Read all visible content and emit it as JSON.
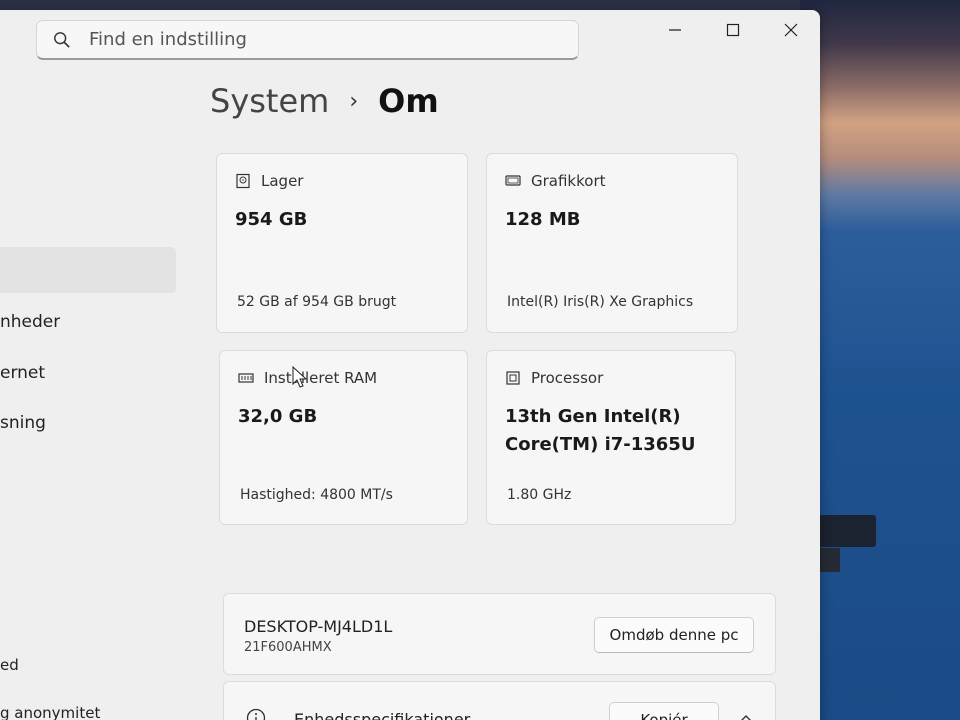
{
  "search": {
    "placeholder": "Find en indstilling"
  },
  "sidebar": {
    "items": [
      {
        "label": "nheder"
      },
      {
        "label": "ernet"
      },
      {
        "label": "sning"
      },
      {
        "label": "ed"
      },
      {
        "label": "g anonymitet"
      }
    ]
  },
  "breadcrumb": {
    "parent": "System",
    "separator": "›",
    "current": "Om"
  },
  "cards": {
    "storage": {
      "label": "Lager",
      "value": "954 GB",
      "sub": "52 GB af 954 GB brugt",
      "icon": "drive-icon"
    },
    "graphics": {
      "label": "Grafikkort",
      "value": "128 MB",
      "sub": "Intel(R) Iris(R) Xe Graphics",
      "icon": "display-icon"
    },
    "ram": {
      "label": "Installeret RAM",
      "value": "32,0 GB",
      "sub": "Hastighed: 4800 MT/s",
      "icon": "memory-icon"
    },
    "processor": {
      "label": "Processor",
      "value_line1": "13th Gen Intel(R)",
      "value_line2": "Core(TM) i7-1365U",
      "sub": "1.80 GHz",
      "icon": "cpu-icon"
    }
  },
  "device": {
    "name": "DESKTOP-MJ4LD1L",
    "serial": "21F600AHMX",
    "rename_label": "Omdøb denne pc"
  },
  "specs": {
    "label": "Enhedsspecifikationer",
    "copy_label": "Kopiér"
  },
  "colors": {
    "window_bg": "#efefef",
    "card_bg": "#f6f6f6",
    "selected_bg": "#e3e3e3"
  }
}
